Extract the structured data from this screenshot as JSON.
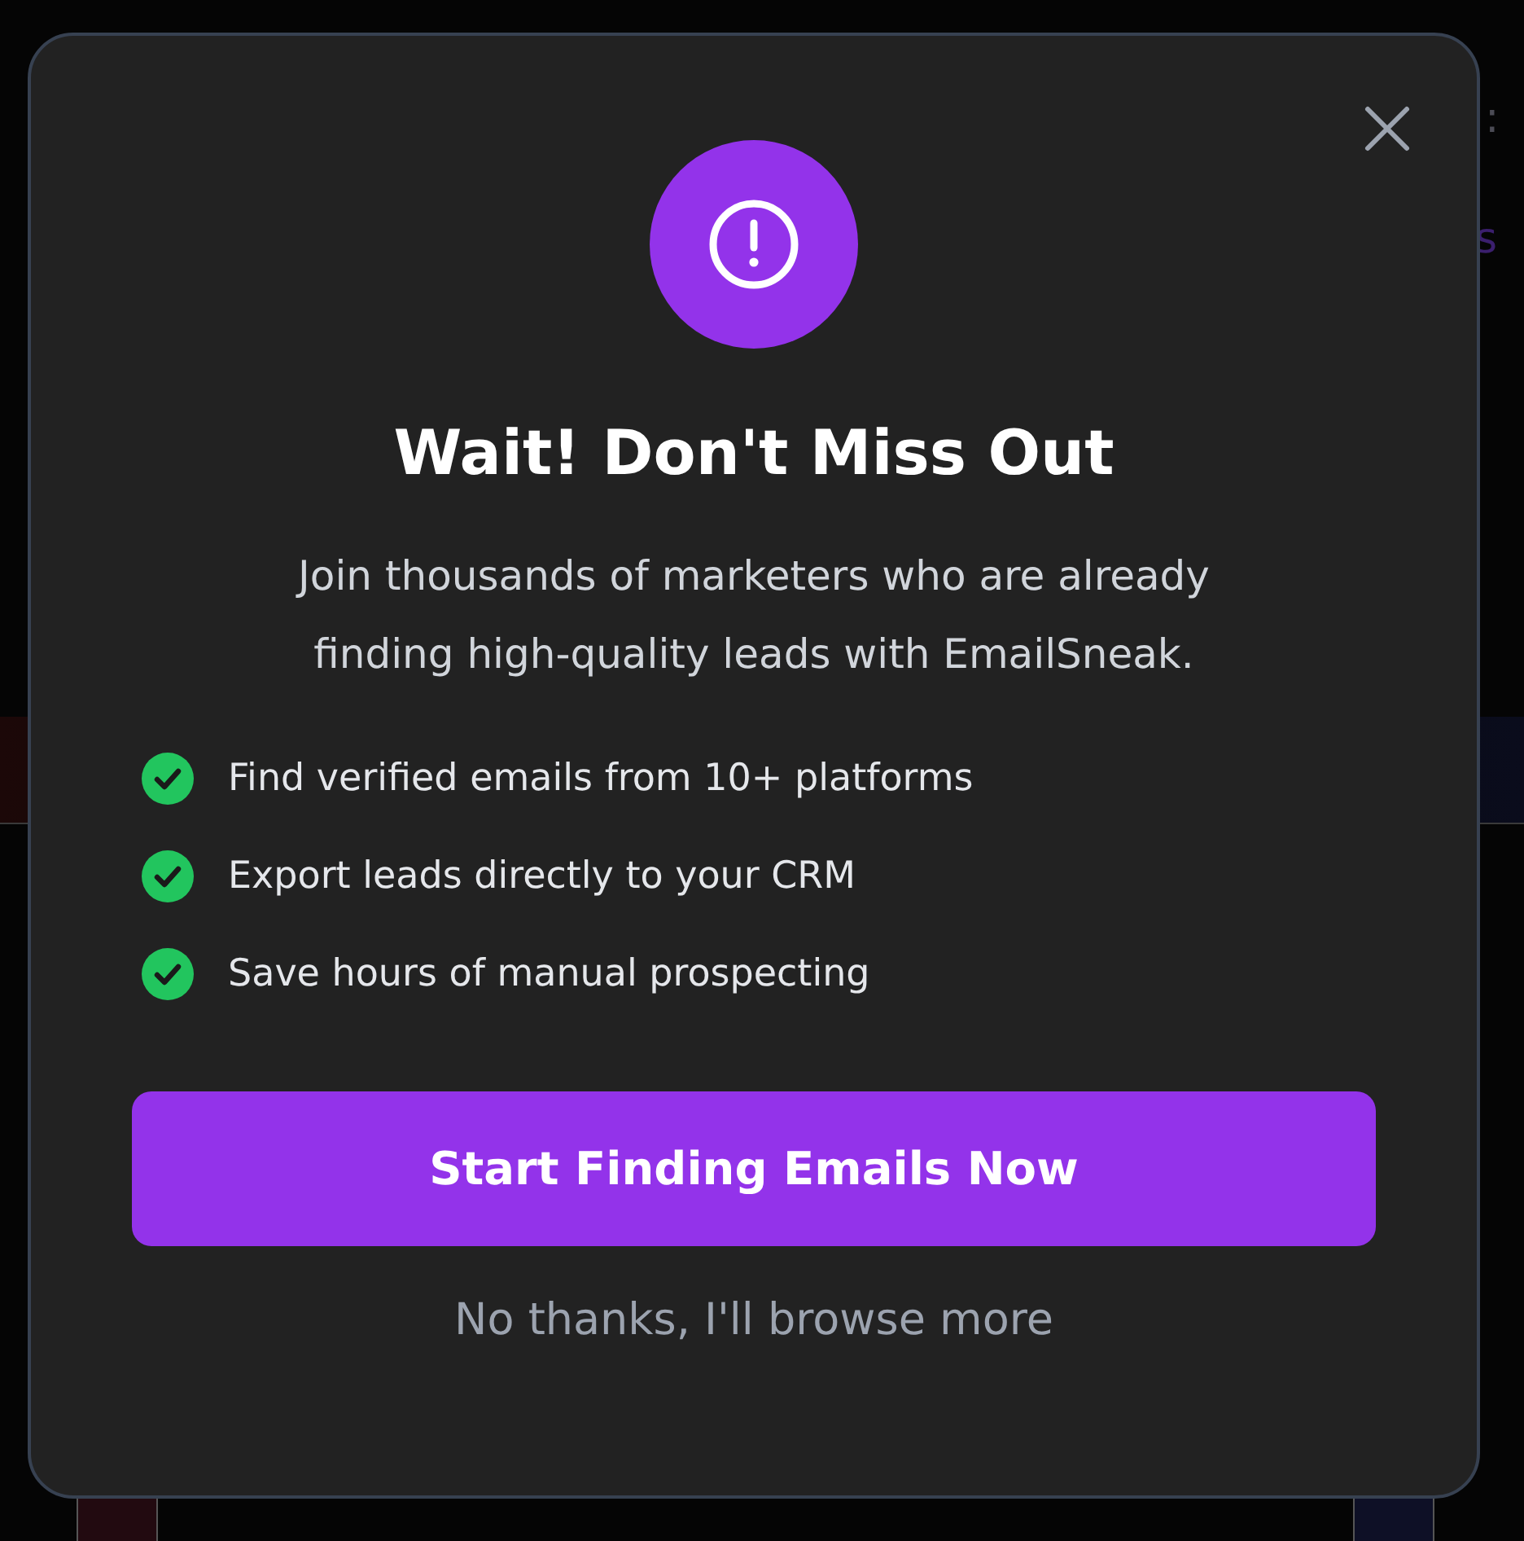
{
  "background": {
    "right_text": "s",
    "right_mark": ":"
  },
  "modal": {
    "title": "Wait! Don't Miss Out",
    "message": "Join thousands of marketers who are already finding high-quality leads with EmailSneak.",
    "features": [
      {
        "text": "Find verified emails from 10+ platforms",
        "checked": true
      },
      {
        "text": "Export leads directly to your CRM",
        "checked": true
      },
      {
        "text": "Save hours of manual prospecting",
        "checked": true
      }
    ],
    "primary_button": "Start Finding Emails Now",
    "secondary_link": "No thanks, I'll browse more"
  }
}
